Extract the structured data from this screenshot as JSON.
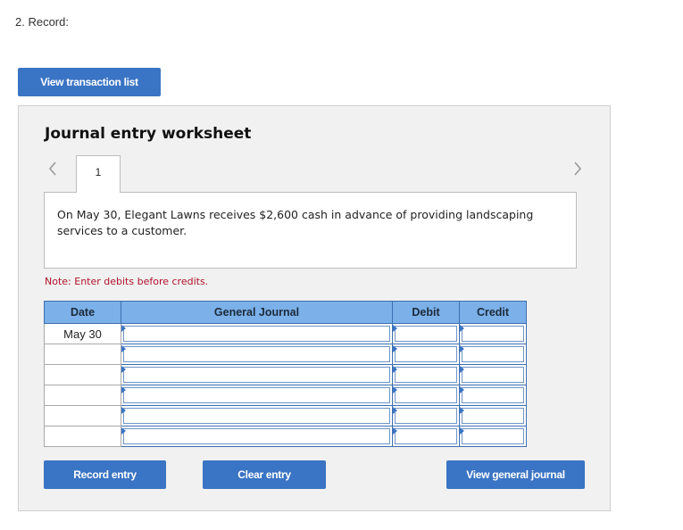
{
  "step": {
    "label": "2. Record:"
  },
  "top_actions": {
    "view_transaction_list": "View transaction list"
  },
  "worksheet": {
    "title": "Journal entry worksheet",
    "current_tab": "1",
    "description": "On May 30, Elegant Lawns receives $2,600 cash in advance of providing landscaping services to a customer.",
    "note": "Note: Enter debits before credits.",
    "table": {
      "headers": {
        "date": "Date",
        "general_journal": "General Journal",
        "debit": "Debit",
        "credit": "Credit"
      },
      "rows": [
        {
          "date": "May 30",
          "account": "",
          "debit": "",
          "credit": ""
        },
        {
          "date": "",
          "account": "",
          "debit": "",
          "credit": ""
        },
        {
          "date": "",
          "account": "",
          "debit": "",
          "credit": ""
        },
        {
          "date": "",
          "account": "",
          "debit": "",
          "credit": ""
        },
        {
          "date": "",
          "account": "",
          "debit": "",
          "credit": ""
        },
        {
          "date": "",
          "account": "",
          "debit": "",
          "credit": ""
        }
      ]
    },
    "buttons": {
      "record_entry": "Record entry",
      "clear_entry": "Clear entry",
      "view_general_journal": "View general journal"
    }
  },
  "icons": {
    "prev": "chevron-left-icon",
    "next": "chevron-right-icon"
  },
  "colors": {
    "button_blue": "#3a74c4",
    "header_blue": "#7bb0e8",
    "note_red": "#b0122a"
  }
}
